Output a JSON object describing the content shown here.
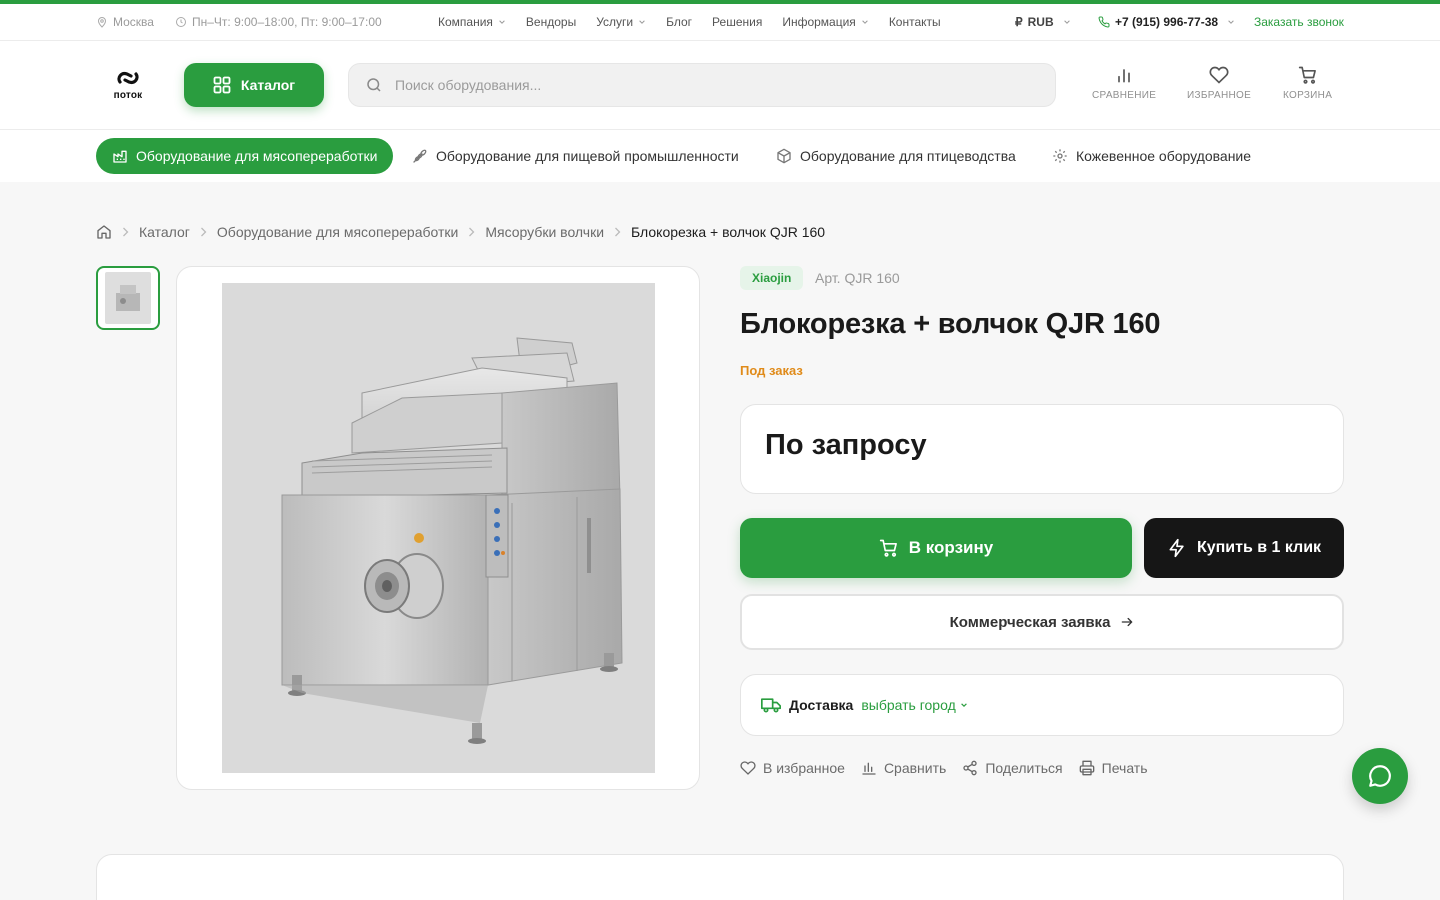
{
  "colors": {
    "accent": "#2a9d3f",
    "dark": "#161616",
    "warning": "#e08b1a"
  },
  "topbar": {
    "city": "Москва",
    "hours": "Пн–Чт: 9:00–18:00, Пт: 9:00–17:00",
    "nav": [
      {
        "label": "Компания",
        "dropdown": true
      },
      {
        "label": "Вендоры",
        "dropdown": false
      },
      {
        "label": "Услуги",
        "dropdown": true
      },
      {
        "label": "Блог",
        "dropdown": false
      },
      {
        "label": "Решения",
        "dropdown": false
      },
      {
        "label": "Информация",
        "dropdown": true
      },
      {
        "label": "Контакты",
        "dropdown": false
      }
    ],
    "currency_symbol": "₽",
    "currency": "RUB",
    "phone": "+7 (915) 996-77-38",
    "callback": "Заказать звонок"
  },
  "header": {
    "logo_text": "поток",
    "catalog_label": "Каталог",
    "search_placeholder": "Поиск оборудования...",
    "compare_label": "СРАВНЕНИЕ",
    "favorites_label": "ИЗБРАННОЕ",
    "cart_label": "КОРЗИНА"
  },
  "categories": [
    {
      "label": "Оборудование для мясопереработки",
      "icon": "factory-icon",
      "active": true
    },
    {
      "label": "Оборудование для пищевой промышленности",
      "icon": "wheat-icon",
      "active": false
    },
    {
      "label": "Оборудование для птицеводства",
      "icon": "box-icon",
      "active": false
    },
    {
      "label": "Кожевенное оборудование",
      "icon": "gear-icon",
      "active": false
    }
  ],
  "breadcrumbs": [
    "Каталог",
    "Оборудование для мясопереработки",
    "Мясорубки волчки",
    "Блокорезка + волчок QJR 160"
  ],
  "product": {
    "brand": "Xiaojin",
    "sku": "Арт. QJR 160",
    "title": "Блокорезка + волчок QJR 160",
    "availability": "Под заказ",
    "price": "По запросу",
    "cart_button": "В корзину",
    "oneclick_button": "Купить в 1 клик",
    "offer_button": "Коммерческая заявка",
    "delivery_label": "Доставка",
    "delivery_city": "выбрать город",
    "actions": {
      "favorite": "В избранное",
      "compare": "Сравнить",
      "share": "Поделиться",
      "print": "Печать"
    }
  }
}
